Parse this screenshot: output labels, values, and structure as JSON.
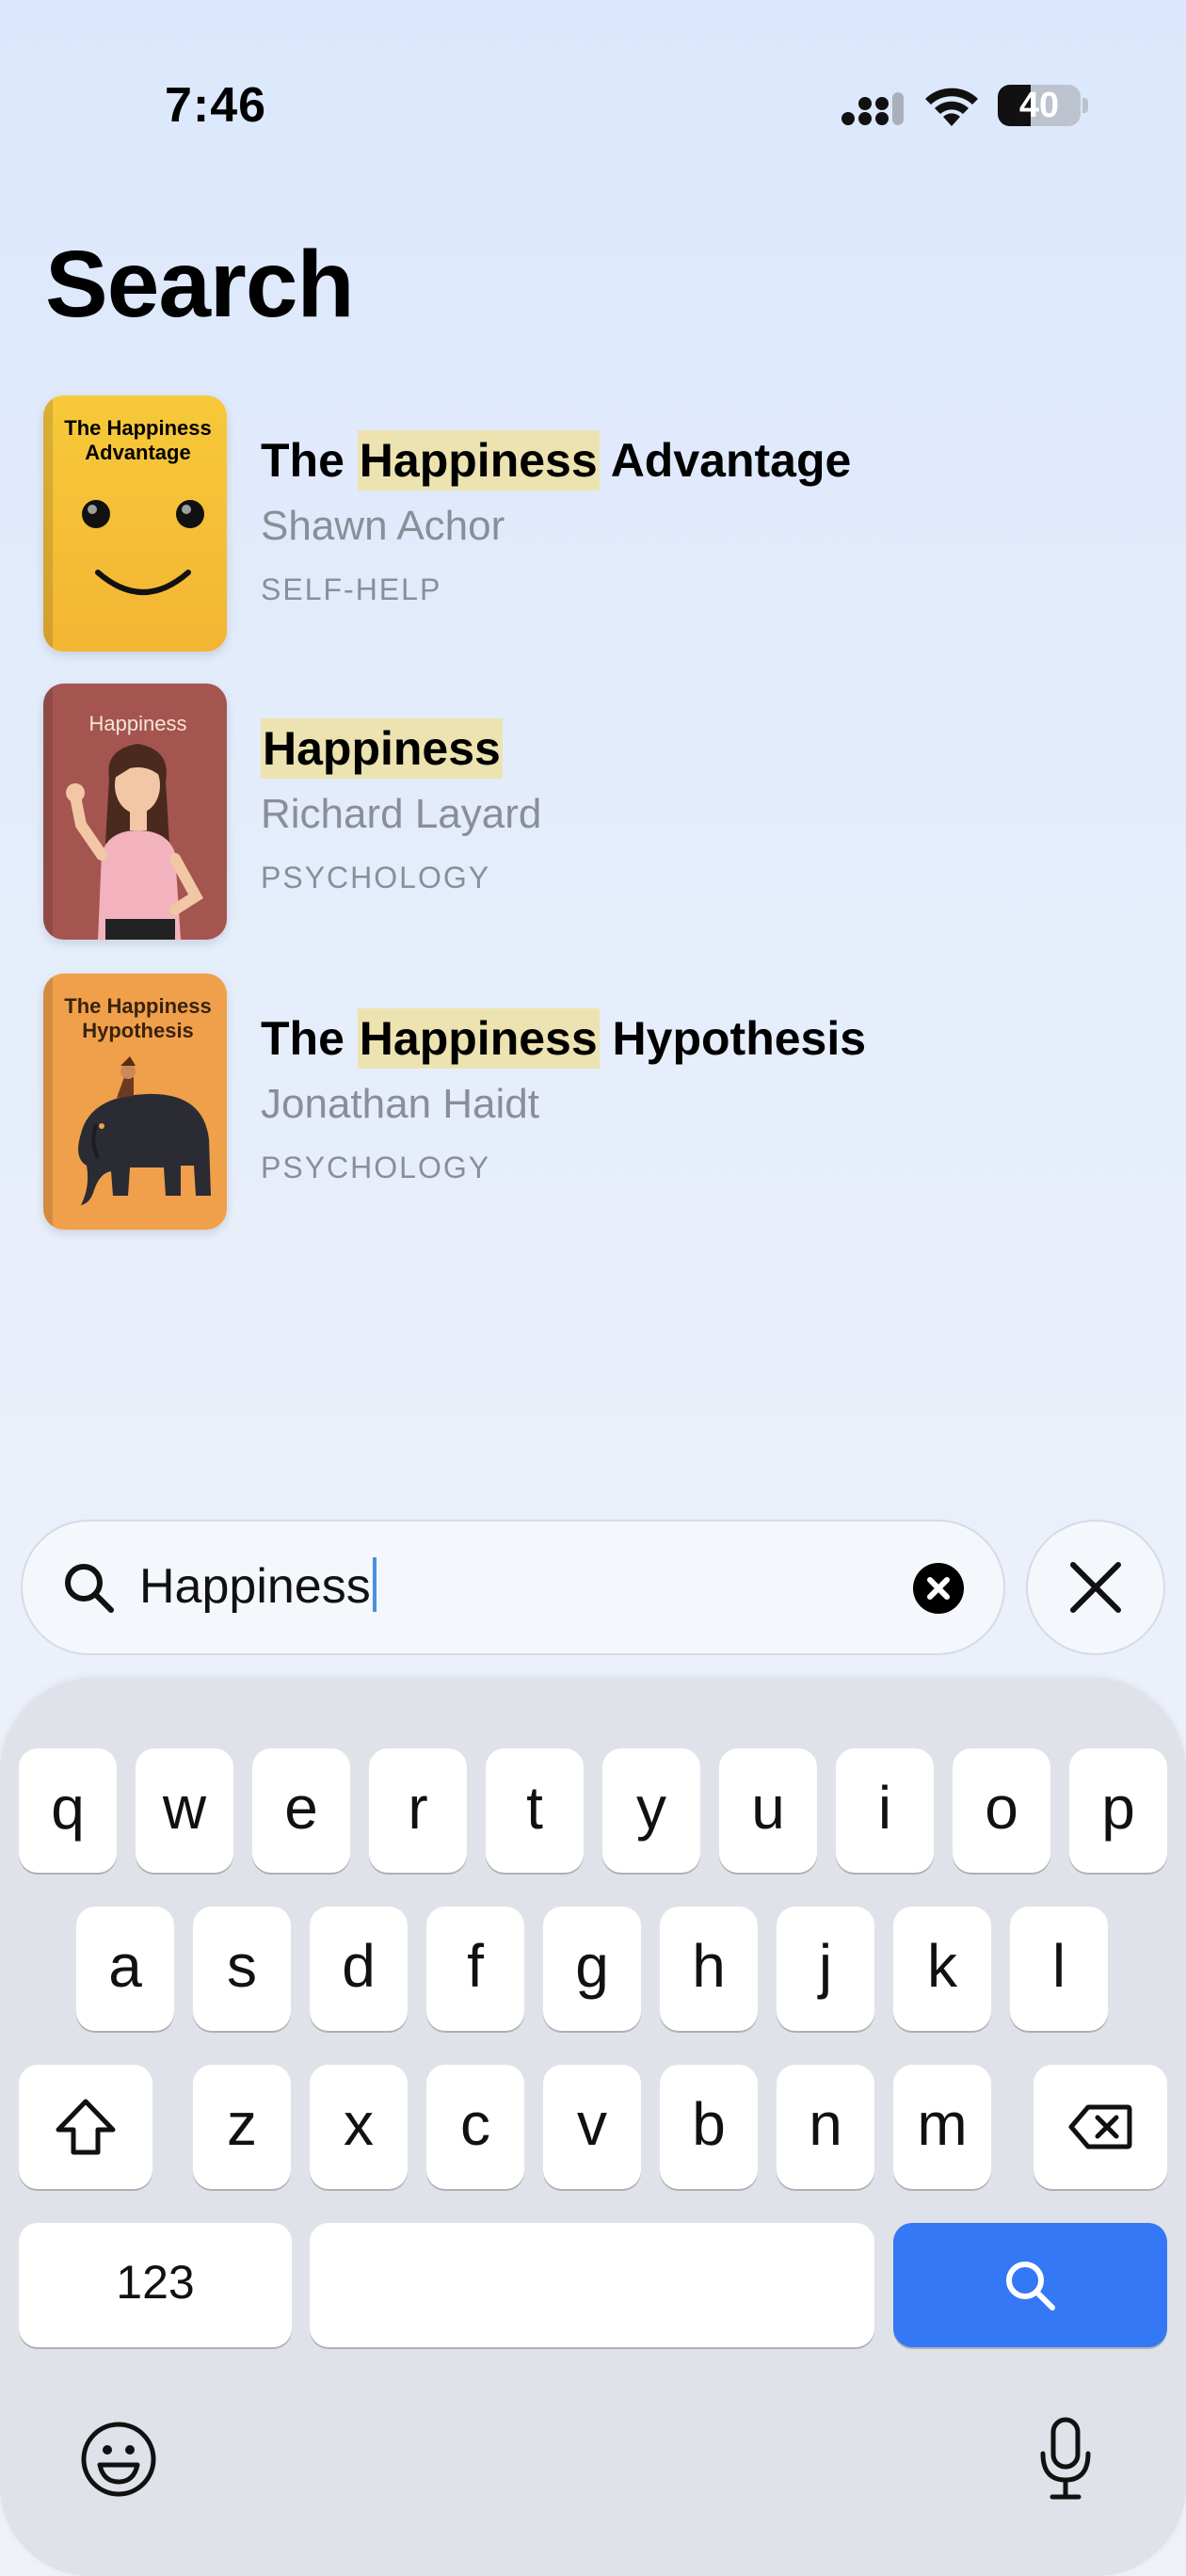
{
  "status": {
    "time": "7:46",
    "battery": "40",
    "battery_level": 0.4
  },
  "page": {
    "title": "Search"
  },
  "results": [
    {
      "title_pre": "The ",
      "title_hl": "Happiness",
      "title_post": " Advantage",
      "author": "Shawn Achor",
      "category": "SELF-HELP",
      "cover_title": "The Happiness Advantage",
      "cover_color": "#f5c133"
    },
    {
      "title_pre": "",
      "title_hl": "Happiness",
      "title_post": "",
      "author": "Richard Layard",
      "category": "PSYCHOLOGY",
      "cover_title": "Happiness",
      "cover_color": "#a4554f"
    },
    {
      "title_pre": "The ",
      "title_hl": "Happiness",
      "title_post": " Hypothesis",
      "author": "Jonathan Haidt",
      "category": "PSYCHOLOGY",
      "cover_title": "The Happiness Hypothesis",
      "cover_color": "#f0a04a"
    }
  ],
  "search": {
    "value": "Happiness"
  },
  "keyboard": {
    "row1": [
      "q",
      "w",
      "e",
      "r",
      "t",
      "y",
      "u",
      "i",
      "o",
      "p"
    ],
    "row2": [
      "a",
      "s",
      "d",
      "f",
      "g",
      "h",
      "j",
      "k",
      "l"
    ],
    "row3": [
      "z",
      "x",
      "c",
      "v",
      "b",
      "n",
      "m"
    ],
    "numbers_label": "123",
    "accent_color": "#3478f6"
  },
  "colors": {
    "highlight": "#ece3b0",
    "secondary_text": "#8a8e98"
  }
}
